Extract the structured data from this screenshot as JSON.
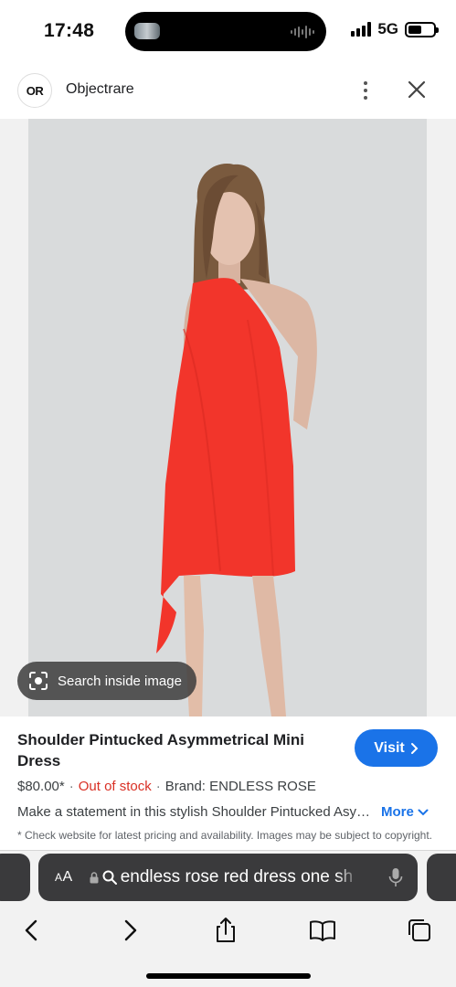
{
  "status_bar": {
    "time": "17:48",
    "network": "5G",
    "battery_level": 0.55
  },
  "site": {
    "logo_text": "OR",
    "name": "Objectrare",
    "more_icon": "more-vertical-icon",
    "close_icon": "close-icon"
  },
  "image": {
    "search_inside_label": "Search inside image",
    "dress_color": "#f2352b",
    "background_color": "#d8dadb"
  },
  "product": {
    "title": "Shoulder Pintucked Asymmetrical Mini Dress",
    "visit_label": "Visit",
    "price": "$80.00*",
    "stock_status": "Out of stock",
    "brand": "Brand: ENDLESS ROSE",
    "description": "Make a statement in this stylish Shoulder Pintucked Asymmetrical Mini Dress",
    "more_label": "More",
    "disclaimer": "* Check website for latest pricing and availability. Images may be subject to copyright."
  },
  "browser": {
    "aa_label_small": "A",
    "aa_label_big": "A",
    "query": "endless rose red dress one sh",
    "accent": "#1a73e8",
    "toolbar": [
      "back-icon",
      "forward-icon",
      "share-icon",
      "bookmarks-icon",
      "tabs-icon"
    ]
  }
}
